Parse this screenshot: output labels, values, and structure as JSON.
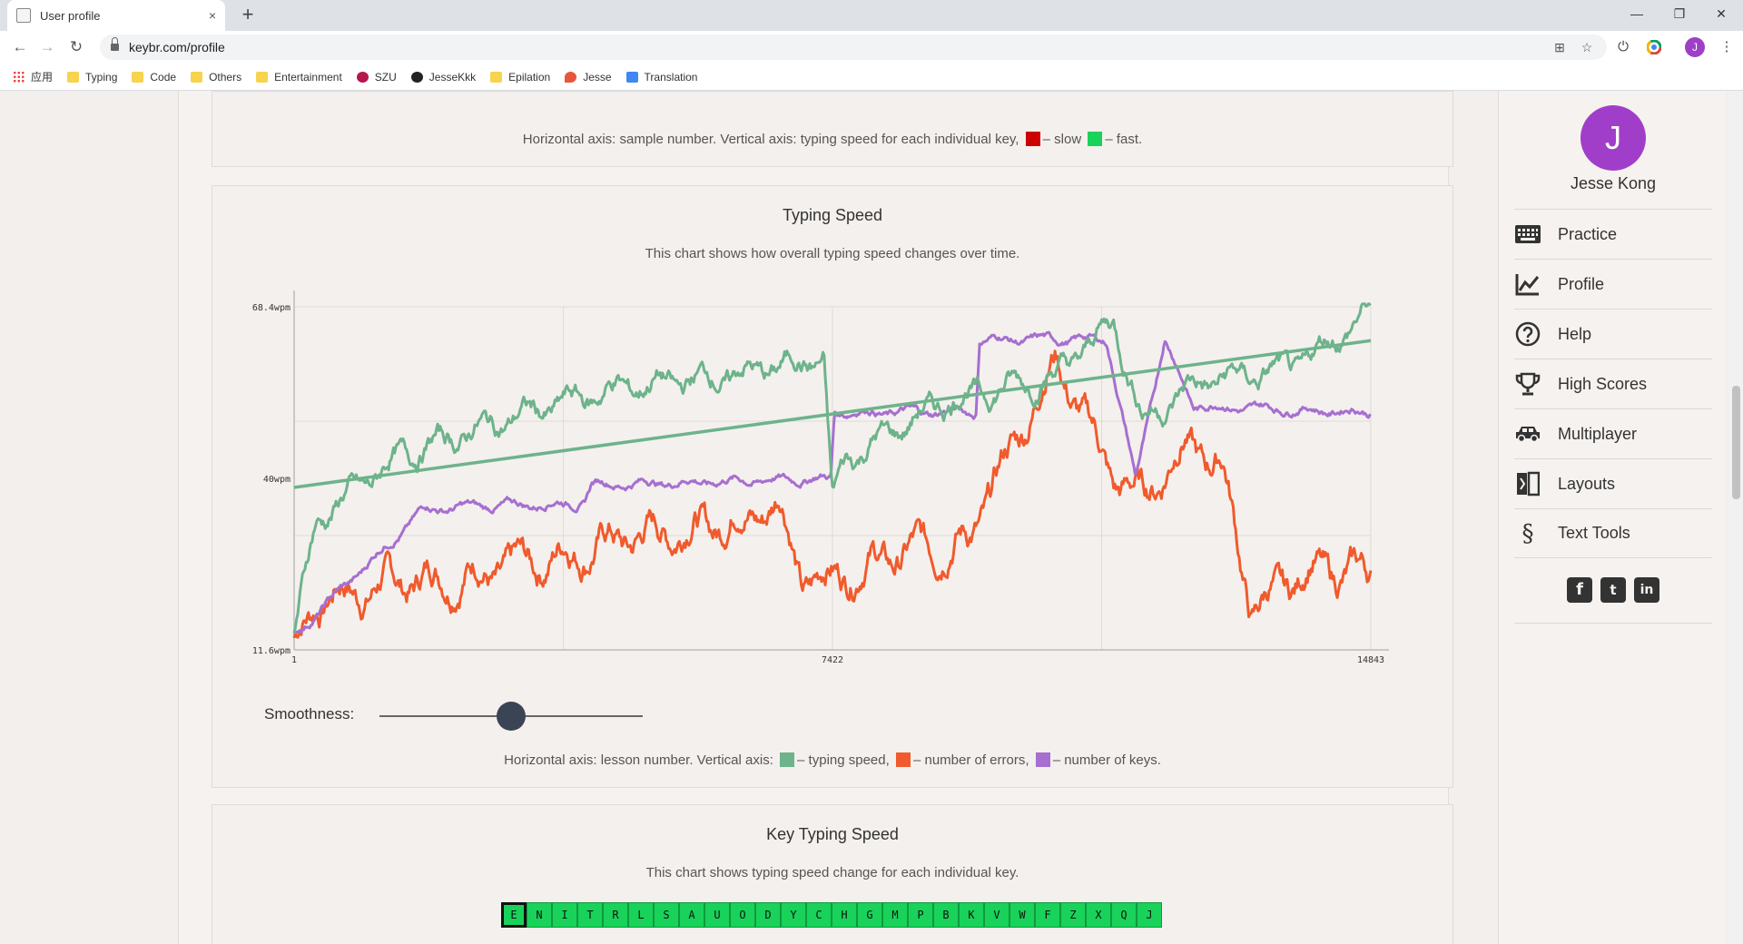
{
  "browser": {
    "tab_title": "User profile",
    "tab_close": "×",
    "new_tab": "+",
    "url": "keybr.com/profile",
    "win_min": "—",
    "win_restore": "❐",
    "win_close": "✕",
    "back": "←",
    "forward": "→",
    "reload": "↻",
    "profile_initial": "J",
    "bookmarks": [
      "应用",
      "Typing",
      "Code",
      "Others",
      "Entertainment",
      "SZU",
      "JesseKkk",
      "Epilation",
      "Jesse",
      "Translation"
    ]
  },
  "key_speed_legend": {
    "prefix": "Horizontal axis: sample number. Vertical axis: typing speed for each individual key,",
    "slow": "– slow",
    "fast": "– fast.",
    "slow_color": "#cc0000",
    "fast_color": "#19d25a"
  },
  "typing_speed": {
    "title": "Typing Speed",
    "description": "This chart shows how overall typing speed changes over time.",
    "smoothness_label": "Smoothness:",
    "smoothness_value": 0.5,
    "legend_prefix": "Horizontal axis: lesson number. Vertical axis:",
    "legend_speed": "– typing speed,",
    "legend_errors": "– number of errors,",
    "legend_keys": "– number of keys.",
    "colors": {
      "speed": "#6db38b",
      "errors": "#f05a2c",
      "keys": "#a66fd0"
    }
  },
  "chart_data": {
    "type": "line",
    "x_tick_labels": [
      "1",
      "7422",
      "14843"
    ],
    "y_tick_labels": [
      "68.4wpm",
      "40wpm",
      "11.6wpm"
    ],
    "xlim": [
      1,
      14843
    ],
    "ylim": [
      11.6,
      68.4
    ],
    "series": [
      {
        "x": [
          1,
          300,
          1500,
          3000,
          4500,
          6000,
          7300,
          7420,
          7600,
          9000,
          10500,
          11300,
          11700,
          12500,
          13800,
          14843
        ],
        "values": [
          14,
          33,
          44,
          50,
          55,
          57,
          60,
          36,
          43,
          53,
          57,
          66,
          50,
          56,
          58,
          68
        ]
      },
      {
        "x": [
          1,
          300,
          1500,
          3000,
          4500,
          6000,
          6700,
          7000,
          7420,
          8500,
          9300,
          10500,
          11300,
          11700,
          12300,
          12800,
          13200,
          14000,
          14843
        ],
        "values": [
          12,
          20,
          23,
          25,
          30,
          33,
          36,
          23,
          24,
          28,
          30,
          60,
          40,
          37,
          46,
          42,
          18,
          25,
          24
        ]
      },
      {
        "x": [
          1,
          1800,
          4000,
          4100,
          7400,
          7450,
          9400,
          9450,
          11200,
          11600,
          12000,
          12400,
          14843
        ],
        "values": [
          14,
          35,
          36,
          39,
          40,
          51,
          51,
          63,
          63,
          40,
          63,
          52,
          51
        ]
      },
      {
        "x": [
          1,
          14843
        ],
        "values": [
          38.5,
          62.8
        ]
      }
    ]
  },
  "key_typing_speed": {
    "title": "Key Typing Speed",
    "description": "This chart shows typing speed change for each individual key.",
    "keys": [
      "E",
      "N",
      "I",
      "T",
      "R",
      "L",
      "S",
      "A",
      "U",
      "O",
      "D",
      "Y",
      "C",
      "H",
      "G",
      "M",
      "P",
      "B",
      "K",
      "V",
      "W",
      "F",
      "Z",
      "X",
      "Q",
      "J"
    ]
  },
  "sidebar": {
    "avatar_initial": "J",
    "user_name": "Jesse Kong",
    "menu": [
      {
        "label": "Practice"
      },
      {
        "label": "Profile"
      },
      {
        "label": "Help"
      },
      {
        "label": "High Scores"
      },
      {
        "label": "Multiplayer"
      },
      {
        "label": "Layouts"
      },
      {
        "label": "Text Tools"
      }
    ],
    "social": [
      "f",
      "t",
      "in"
    ]
  }
}
